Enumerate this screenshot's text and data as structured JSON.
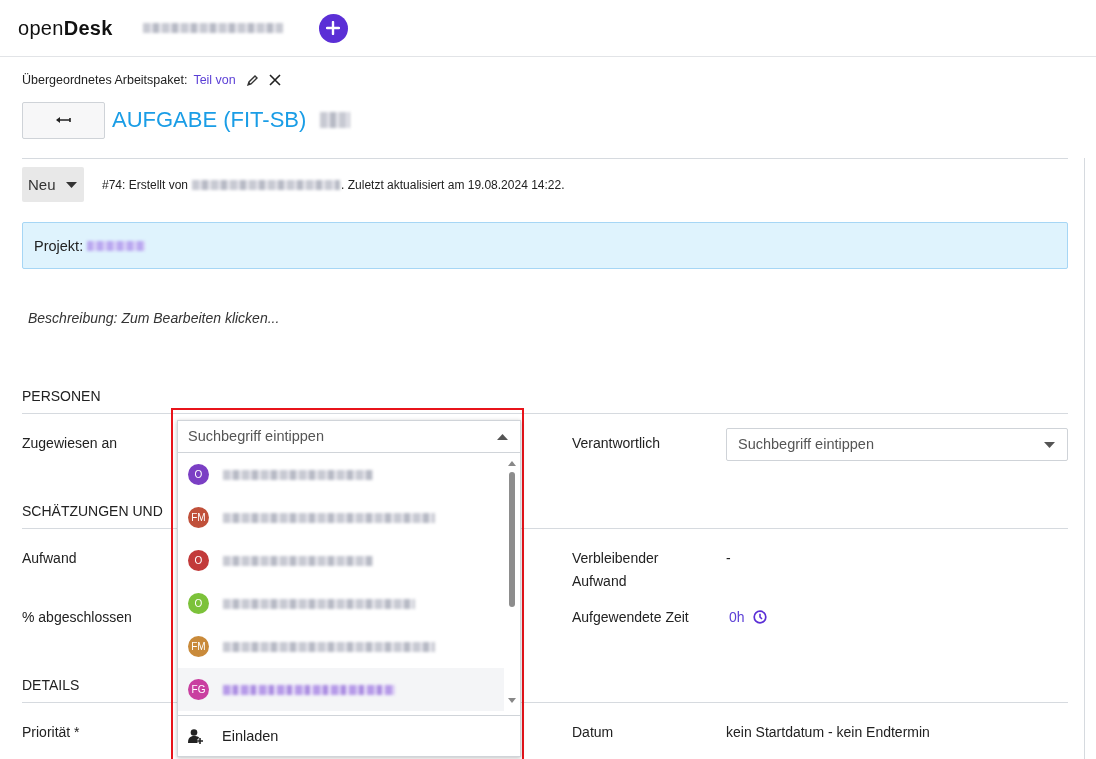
{
  "header": {
    "logo": "open**Desk**"
  },
  "parent": {
    "label": "Übergeordnetes Arbeitspaket:",
    "link": "Teil von"
  },
  "title": "AUFGABE (FIT-SB)",
  "status": {
    "value": "Neu",
    "info_prefix": "#74: Erstellt von",
    "info_suffix": ". Zuletzt aktualisiert am 19.08.2024 14:22."
  },
  "project": {
    "label": "Projekt:"
  },
  "description": "Beschreibung: Zum Bearbeiten klicken...",
  "sections": [
    {
      "title": "PERSONEN",
      "rows": [
        {
          "left": {
            "label": "Zugewiesen an",
            "kind": "anchor"
          },
          "right": {
            "label": "Verantwortlich",
            "kind": "select",
            "placeholder": "Suchbegriff eintippen"
          }
        }
      ]
    },
    {
      "title": "SCHÄTZUNGEN UND",
      "rows": [
        {
          "left": {
            "label": "Aufwand"
          },
          "right": {
            "label": "Verbleibender Aufwand",
            "kind": "text",
            "value": "-"
          }
        },
        {
          "left": {
            "label": "% abgeschlossen"
          },
          "right": {
            "label": "Aufgewendete Zeit",
            "kind": "time",
            "value": "0h"
          }
        }
      ]
    },
    {
      "title": "DETAILS",
      "rows": [
        {
          "left": {
            "label": "Priorität *"
          },
          "right": {
            "label": "Datum",
            "kind": "text",
            "value": "kein Startdatum - kein Endtermin"
          }
        }
      ]
    }
  ],
  "dropdown": {
    "placeholder": "Suchbegriff eintippen",
    "expanded": true,
    "footer": "Einladen",
    "options": [
      {
        "initials": "O",
        "color": "#7b3fc4",
        "selected": false
      },
      {
        "initials": "FM",
        "color": "#c0503a",
        "selected": false
      },
      {
        "initials": "O",
        "color": "#c23a3a",
        "selected": false
      },
      {
        "initials": "O",
        "color": "#7cc23a",
        "selected": false
      },
      {
        "initials": "FM",
        "color": "#c98a3a",
        "selected": false
      },
      {
        "initials": "FG",
        "color": "#c93fa0",
        "selected": true
      }
    ]
  }
}
